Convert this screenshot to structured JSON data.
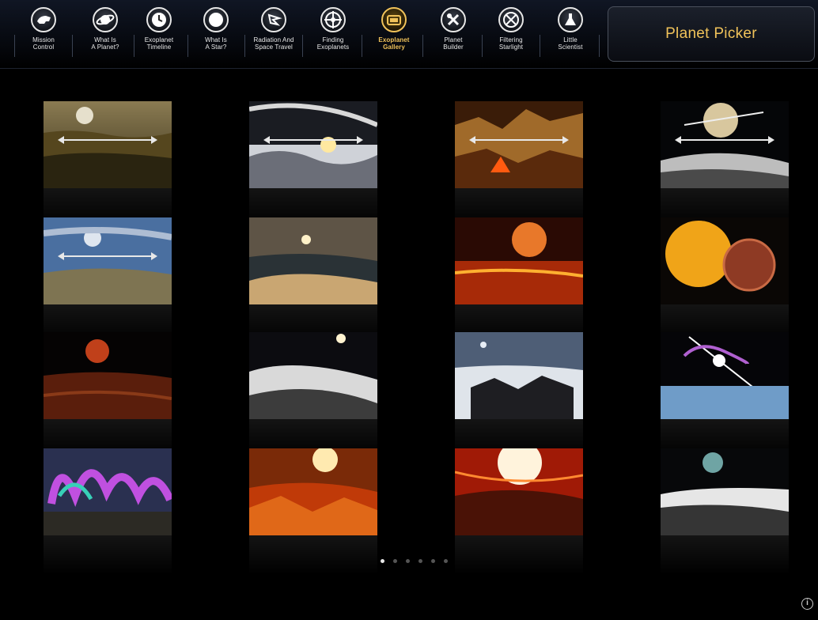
{
  "nav": {
    "items": [
      {
        "label": "Mission\nControl",
        "icon": "mission-control-icon"
      },
      {
        "label": "What Is\nA Planet?",
        "icon": "planet-icon"
      },
      {
        "label": "Exoplanet\nTimeline",
        "icon": "clock-icon"
      },
      {
        "label": "What Is\nA Star?",
        "icon": "star-icon"
      },
      {
        "label": "Radiation And\nSpace Travel",
        "icon": "radiation-icon"
      },
      {
        "label": "Finding\nExoplanets",
        "icon": "crosshair-icon"
      },
      {
        "label": "Exoplanet\nGallery",
        "icon": "gallery-icon",
        "active": true
      },
      {
        "label": "Planet\nBuilder",
        "icon": "tools-icon"
      },
      {
        "label": "Filtering\nStarlight",
        "icon": "filter-icon"
      },
      {
        "label": "Little\nScientist",
        "icon": "flask-icon"
      }
    ],
    "picker_label": "Planet Picker"
  },
  "gallery": {
    "thumbnails": [
      {
        "name": "desert-plain-moon",
        "has_arrows": true
      },
      {
        "name": "ringed-planet-clouds",
        "has_arrows": true
      },
      {
        "name": "volcanic-mountains",
        "has_arrows": true
      },
      {
        "name": "saturn-over-ice",
        "has_arrows": true
      },
      {
        "name": "blue-sky-plains",
        "has_arrows": true
      },
      {
        "name": "rocky-shore",
        "has_arrows": false
      },
      {
        "name": "red-sun-lava-sea",
        "has_arrows": false
      },
      {
        "name": "giant-star-and-planet",
        "has_arrows": false
      },
      {
        "name": "red-dwarf-plain",
        "has_arrows": false
      },
      {
        "name": "snowy-ridge",
        "has_arrows": false
      },
      {
        "name": "icy-rocks-moons",
        "has_arrows": false
      },
      {
        "name": "flare-over-ice",
        "has_arrows": false
      },
      {
        "name": "aurora-plain",
        "has_arrows": false
      },
      {
        "name": "glowing-sun-lava",
        "has_arrows": false
      },
      {
        "name": "white-sun-red-terrain",
        "has_arrows": false
      },
      {
        "name": "teal-moon-ice-shore",
        "has_arrows": false
      }
    ]
  },
  "pager": {
    "count": 6,
    "current": 1
  },
  "info_label": "i",
  "colors": {
    "accent": "#f0c25a",
    "background": "#000000"
  }
}
